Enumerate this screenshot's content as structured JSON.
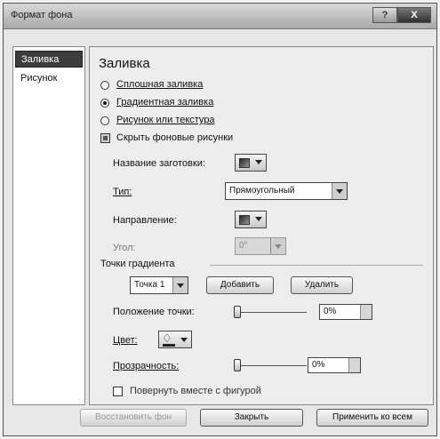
{
  "window": {
    "title": "Формат фона",
    "help_label": "?",
    "close_label": "X"
  },
  "sidebar": {
    "items": [
      {
        "label": "Заливка",
        "selected": true
      },
      {
        "label": "Рисунок",
        "selected": false
      }
    ]
  },
  "fill": {
    "section_title": "Заливка",
    "options": [
      {
        "label": "Сплошная заливка",
        "checked": false
      },
      {
        "label": "Градиентная заливка",
        "checked": true
      },
      {
        "label": "Рисунок или текстура",
        "checked": false
      }
    ],
    "hide_background_label": "Скрыть фоновые рисунки",
    "hide_background_checked": true,
    "preset_label": "Название заготовки:",
    "type_label": "Тип:",
    "type_value": "Прямоугольный",
    "direction_label": "Направление:",
    "angle_label": "Угол:",
    "angle_value": "0°",
    "stops_title": "Точки градиента",
    "stop_value": "Точка 1",
    "add_label": "Добавить",
    "remove_label": "Удалить",
    "stop_position_label": "Положение точки:",
    "stop_position_value": "0%",
    "color_label": "Цвет:",
    "transparency_label": "Прозрачность:",
    "transparency_value": "0%",
    "rotate_label": "Повернуть вместе с фигурой",
    "rotate_checked": false
  },
  "footer": {
    "reset_label": "Восстановить фон",
    "close_label": "Закрыть",
    "apply_all_label": "Применить ко всем"
  }
}
